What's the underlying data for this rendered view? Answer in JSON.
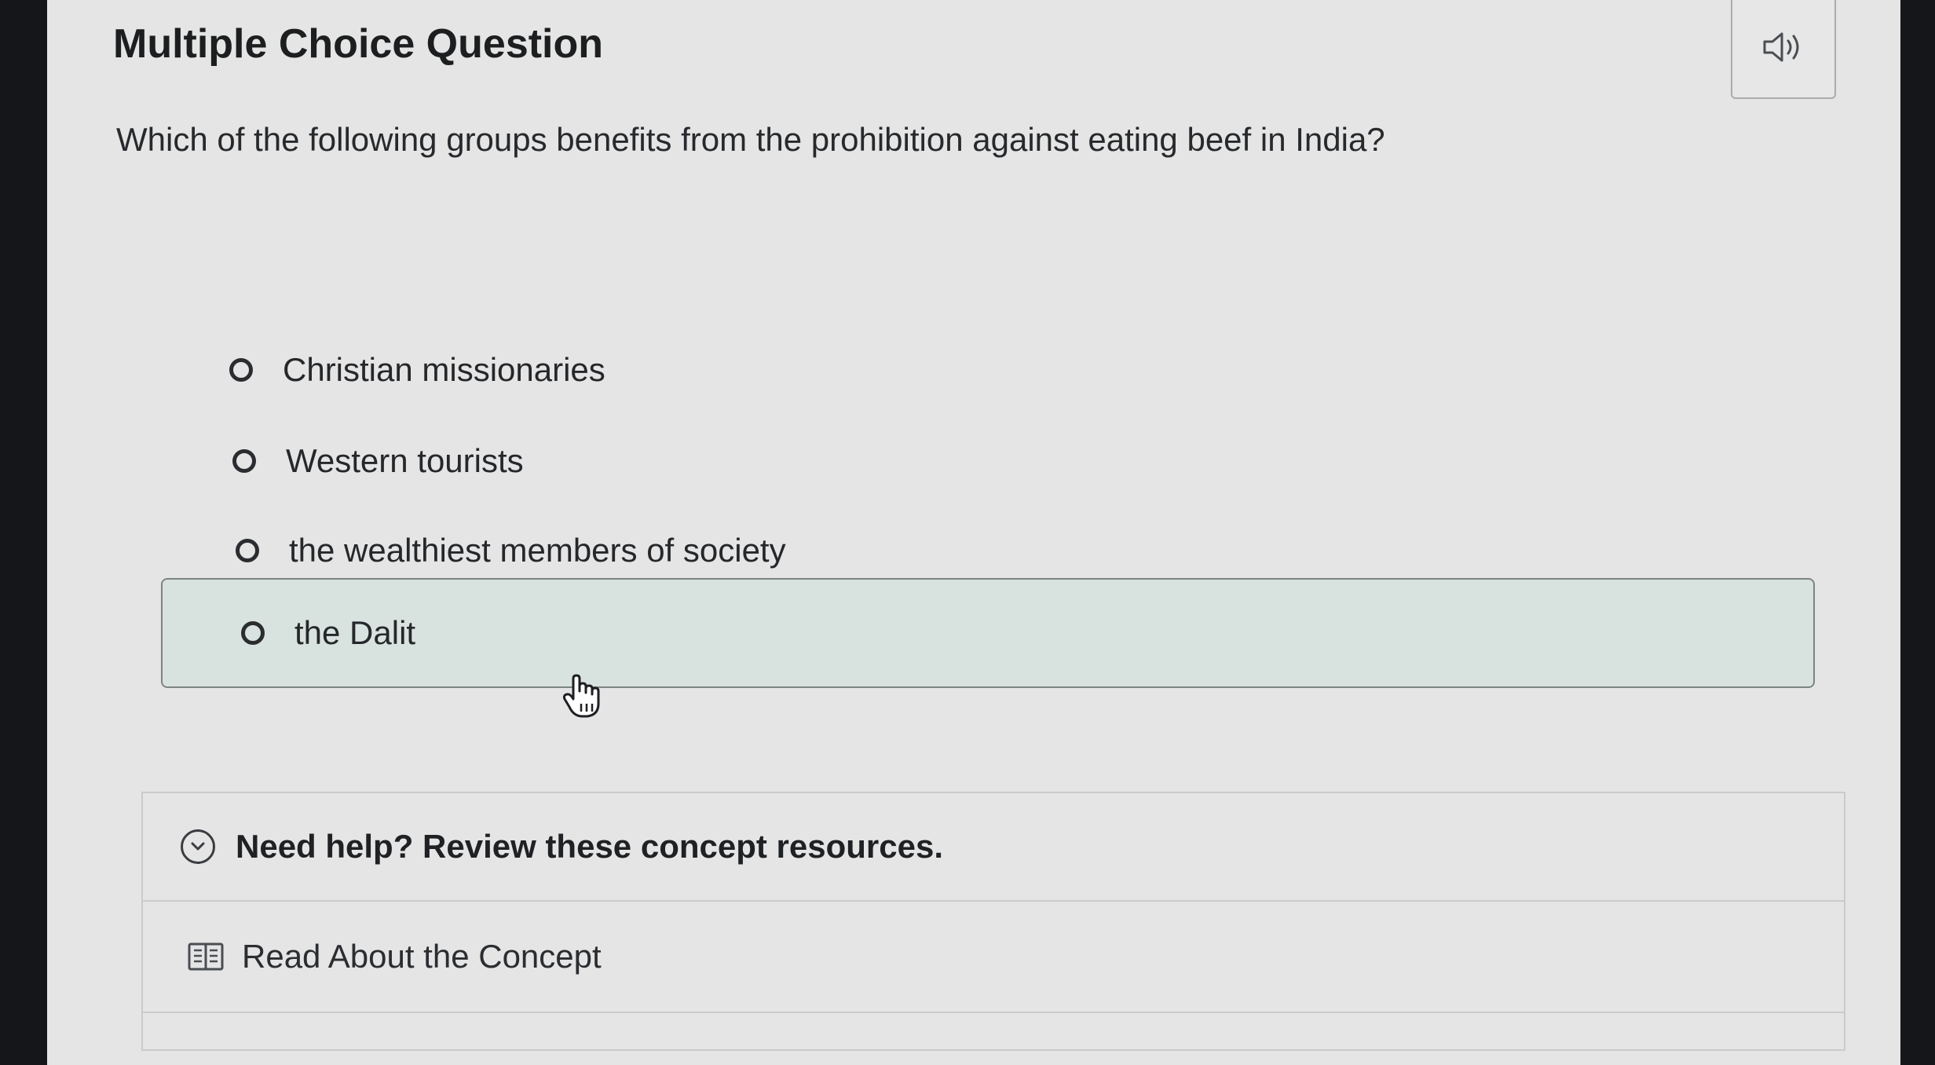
{
  "header": {
    "title": "Multiple Choice Question"
  },
  "audio": {
    "icon": "speaker-icon"
  },
  "question": {
    "text": "Which of the following groups benefits from the prohibition against eating beef in India?"
  },
  "options": [
    {
      "label": "Christian missionaries",
      "selected": false,
      "hovered": false
    },
    {
      "label": "Western tourists",
      "selected": false,
      "hovered": false
    },
    {
      "label": "the wealthiest members of society",
      "selected": false,
      "hovered": false
    },
    {
      "label": "the Dalit",
      "selected": false,
      "hovered": true
    }
  ],
  "help": {
    "title": "Need help? Review these concept resources.",
    "toggle_icon": "chevron-down-icon",
    "resources": [
      {
        "label": "Read About the Concept",
        "icon": "book-icon"
      }
    ]
  },
  "colors": {
    "background": "#e4e5e4",
    "hover_highlight": "#d8e2de",
    "text": "#25272a"
  }
}
